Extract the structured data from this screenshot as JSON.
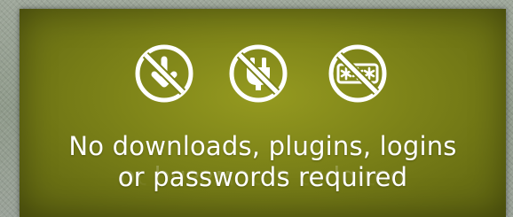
{
  "banner": {
    "icons": [
      "no-download-icon",
      "no-plugin-icon",
      "no-password-icon"
    ],
    "line1": "No downloads, plugins, logins",
    "line2": "or passwords required",
    "colors": {
      "panel": "#7c8218",
      "text": "#ffffff",
      "background": "#959e91"
    }
  }
}
